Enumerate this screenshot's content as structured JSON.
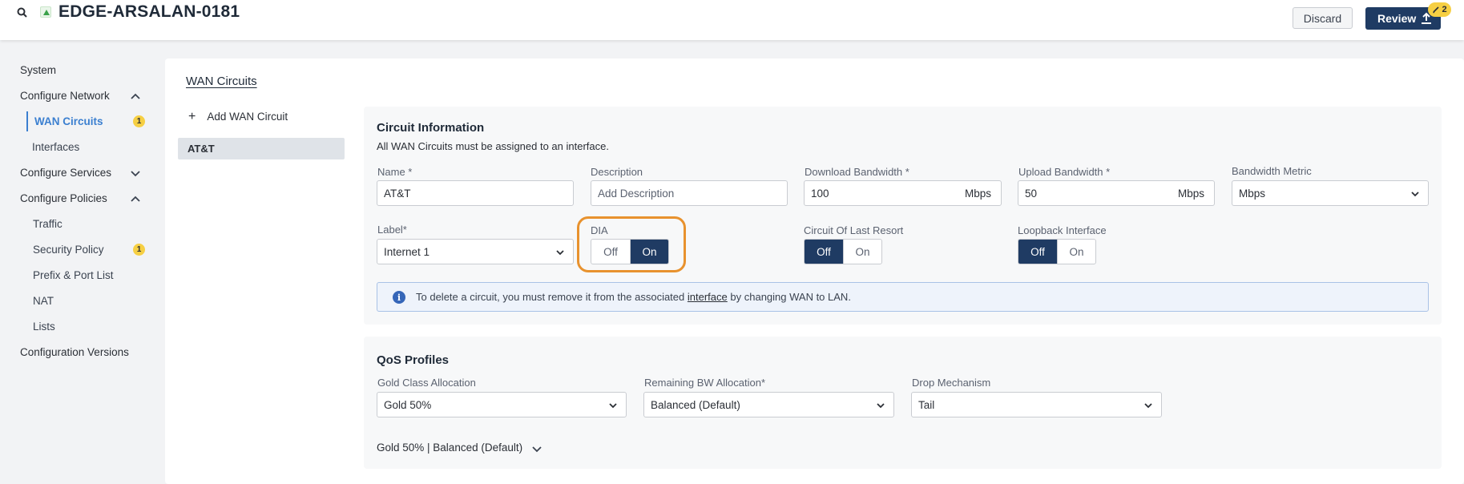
{
  "header": {
    "title": "EDGE-ARSALAN-0181",
    "discard_label": "Discard",
    "review_label": "Review",
    "pending_count": "2"
  },
  "sidebar": {
    "items": [
      {
        "label": "System"
      },
      {
        "label": "Configure Network"
      },
      {
        "label": "WAN Circuits",
        "badge": "1"
      },
      {
        "label": "Interfaces"
      },
      {
        "label": "Configure Services"
      },
      {
        "label": "Configure Policies"
      },
      {
        "label": "Traffic"
      },
      {
        "label": "Security Policy",
        "badge": "1"
      },
      {
        "label": "Prefix & Port List"
      },
      {
        "label": "NAT"
      },
      {
        "label": "Lists"
      },
      {
        "label": "Configuration Versions"
      }
    ]
  },
  "main": {
    "title": "WAN Circuits",
    "add_label": "Add WAN Circuit",
    "circuits": [
      "AT&T"
    ]
  },
  "circuit_info": {
    "title": "Circuit Information",
    "subtitle": "All WAN Circuits must be assigned to an interface.",
    "name_label": "Name *",
    "name_value": "AT&T",
    "description_label": "Description",
    "description_placeholder": "Add Description",
    "download_label": "Download Bandwidth *",
    "download_value": "100",
    "download_unit": "Mbps",
    "upload_label": "Upload Bandwidth *",
    "upload_value": "50",
    "upload_unit": "Mbps",
    "metric_label": "Bandwidth Metric",
    "metric_value": "Mbps",
    "label_label": "Label*",
    "label_value": "Internet 1",
    "dia_label": "DIA",
    "dia_off": "Off",
    "dia_on": "On",
    "dia_selected": "On",
    "last_resort_label": "Circuit Of Last Resort",
    "last_resort_off": "Off",
    "last_resort_on": "On",
    "last_resort_selected": "Off",
    "loopback_label": "Loopback Interface",
    "loopback_off": "Off",
    "loopback_on": "On",
    "loopback_selected": "Off",
    "info_text_before": "To delete a circuit, you must remove it from the associated",
    "info_link": "interface",
    "info_text_after": "by changing WAN to LAN."
  },
  "qos": {
    "title": "QoS Profiles",
    "gold_label": "Gold Class Allocation",
    "gold_value": "Gold 50%",
    "remaining_label": "Remaining BW Allocation*",
    "remaining_value": "Balanced (Default)",
    "drop_label": "Drop Mechanism",
    "drop_value": "Tail",
    "summary": "Gold 50% | Balanced (Default)"
  },
  "colors": {
    "primary": "#1f3b63",
    "accent": "#3b7fd0",
    "badge": "#f6cf43",
    "highlight": "#e8922e"
  }
}
